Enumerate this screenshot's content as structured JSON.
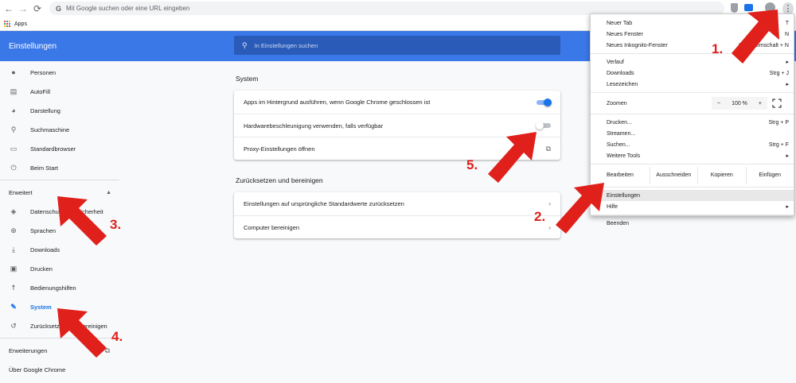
{
  "browser": {
    "nav": {
      "back": "←",
      "forward": "→",
      "reload": "⟳"
    },
    "omnibox_placeholder": "Mit Google suchen oder eine URL eingeben",
    "bookmarks_apps": "Apps",
    "menu_dots": "⋮"
  },
  "header": {
    "title": "Einstellungen",
    "search_placeholder": "In Einstellungen suchen"
  },
  "sidebar": {
    "items": [
      {
        "label": "Personen",
        "icon": "person-icon"
      },
      {
        "label": "AutoFill",
        "icon": "clipboard-icon"
      },
      {
        "label": "Darstellung",
        "icon": "palette-icon"
      },
      {
        "label": "Suchmaschine",
        "icon": "search-icon"
      },
      {
        "label": "Standardbrowser",
        "icon": "browser-icon"
      },
      {
        "label": "Beim Start",
        "icon": "power-icon"
      }
    ],
    "advanced_label": "Erweitert",
    "advanced_items": [
      {
        "label": "Datenschutz und Sicherheit",
        "icon": "shield-icon"
      },
      {
        "label": "Sprachen",
        "icon": "globe-icon"
      },
      {
        "label": "Downloads",
        "icon": "download-icon"
      },
      {
        "label": "Drucken",
        "icon": "printer-icon"
      },
      {
        "label": "Bedienungshilfen",
        "icon": "accessibility-icon"
      },
      {
        "label": "System",
        "icon": "wrench-icon",
        "active": true
      },
      {
        "label": "Zurücksetzen und bereinigen",
        "icon": "history-icon"
      }
    ],
    "extensions_label": "Erweiterungen",
    "about_label": "Über Google Chrome"
  },
  "main": {
    "system_title": "System",
    "system_rows": [
      {
        "label": "Apps im Hintergrund ausführen, wenn Google Chrome geschlossen ist",
        "control": "toggle",
        "on": true
      },
      {
        "label": "Hardwarebeschleunigung verwenden, falls verfügbar",
        "control": "toggle",
        "on": false
      },
      {
        "label": "Proxy-Einstellungen öffnen",
        "control": "external-link"
      }
    ],
    "reset_title": "Zurücksetzen und bereinigen",
    "reset_rows": [
      {
        "label": "Einstellungen auf ursprüngliche Standardwerte zurücksetzen"
      },
      {
        "label": "Computer bereinigen"
      }
    ]
  },
  "menu": {
    "group1": [
      {
        "label": "Neuer Tab",
        "shortcut": "T"
      },
      {
        "label": "Neues Fenster",
        "shortcut": "N"
      },
      {
        "label": "Neues Inkognito-Fenster",
        "shortcut": "Strg + Umschalt + N"
      }
    ],
    "group2": [
      {
        "label": "Verlauf",
        "submenu": true
      },
      {
        "label": "Downloads",
        "shortcut": "Strg + J"
      },
      {
        "label": "Lesezeichen",
        "submenu": true
      }
    ],
    "zoom": {
      "label": "Zoomen",
      "minus": "−",
      "value": "100 %",
      "plus": "+"
    },
    "group3": [
      {
        "label": "Drucken...",
        "shortcut": "Strg + P"
      },
      {
        "label": "Streamen..."
      },
      {
        "label": "Suchen...",
        "shortcut": "Strg + F"
      },
      {
        "label": "Weitere Tools",
        "submenu": true
      }
    ],
    "edit": {
      "label": "Bearbeiten",
      "cut": "Ausschneiden",
      "copy": "Kopieren",
      "paste": "Einfügen"
    },
    "group4": [
      {
        "label": "Einstellungen",
        "highlighted": true
      },
      {
        "label": "Hilfe",
        "submenu": true
      }
    ],
    "exit": "Beenden"
  },
  "annotations": [
    "1.",
    "2.",
    "3.",
    "4.",
    "5."
  ],
  "colors": {
    "header": "#3b78e7",
    "accent": "#1a73e8",
    "arrow": "#e0201b"
  }
}
